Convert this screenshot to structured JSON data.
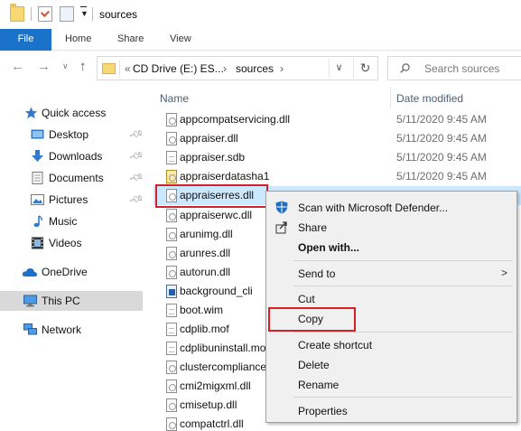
{
  "window": {
    "title": "sources"
  },
  "ribbon": {
    "tabs": [
      "File",
      "Home",
      "Share",
      "View"
    ]
  },
  "address": {
    "chevron": "«",
    "crumbs": [
      "CD Drive (E:) ES...",
      "sources"
    ],
    "separator": "›",
    "search_placeholder": "Search sources"
  },
  "navpane": {
    "items": [
      {
        "label": "Quick access",
        "icon": "star-icon"
      },
      {
        "label": "Desktop",
        "icon": "desktop-icon",
        "pinned": true
      },
      {
        "label": "Downloads",
        "icon": "download-arrow-icon",
        "pinned": true
      },
      {
        "label": "Documents",
        "icon": "documents-icon",
        "pinned": true
      },
      {
        "label": "Pictures",
        "icon": "pictures-icon",
        "pinned": true
      },
      {
        "label": "Music",
        "icon": "music-note-icon"
      },
      {
        "label": "Videos",
        "icon": "film-icon"
      },
      {
        "label": "OneDrive",
        "icon": "cloud-icon"
      },
      {
        "label": "This PC",
        "icon": "computer-icon",
        "selected": true
      },
      {
        "label": "Network",
        "icon": "network-icon"
      }
    ]
  },
  "list": {
    "columns": {
      "name": "Name",
      "date": "Date modified"
    },
    "files": [
      {
        "name": "appcompatservicing.dll",
        "date": "5/11/2020 9:45 AM",
        "icon": "dll-file-icon"
      },
      {
        "name": "appraiser.dll",
        "date": "5/11/2020 9:45 AM",
        "icon": "dll-file-icon"
      },
      {
        "name": "appraiser.sdb",
        "date": "5/11/2020 9:45 AM",
        "icon": "file-icon"
      },
      {
        "name": "appraiserdatasha1",
        "date": "5/11/2020 9:45 AM",
        "icon": "setup-file-icon"
      },
      {
        "name": "appraiserres.dll",
        "date": "",
        "icon": "dll-file-icon",
        "selected": true
      },
      {
        "name": "appraiserwc.dll",
        "date": "",
        "icon": "dll-file-icon"
      },
      {
        "name": "arunimg.dll",
        "date": "",
        "icon": "dll-file-icon"
      },
      {
        "name": "arunres.dll",
        "date": "",
        "icon": "dll-file-icon"
      },
      {
        "name": "autorun.dll",
        "date": "",
        "icon": "dll-file-icon"
      },
      {
        "name": "background_cli",
        "date": "",
        "icon": "image-file-icon"
      },
      {
        "name": "boot.wim",
        "date": "",
        "icon": "file-icon"
      },
      {
        "name": "cdplib.mof",
        "date": "",
        "icon": "file-icon"
      },
      {
        "name": "cdplibuninstall.mof",
        "date": "",
        "icon": "file-icon"
      },
      {
        "name": "clustercompliance",
        "date": "",
        "icon": "dll-file-icon"
      },
      {
        "name": "cmi2migxml.dll",
        "date": "",
        "icon": "dll-file-icon"
      },
      {
        "name": "cmisetup.dll",
        "date": "",
        "icon": "dll-file-icon"
      },
      {
        "name": "compatctrl.dll",
        "date": "",
        "icon": "dll-file-icon"
      }
    ]
  },
  "context_menu": {
    "items": [
      {
        "label": "Scan with Microsoft Defender...",
        "icon": "defender-shield-icon"
      },
      {
        "label": "Share",
        "icon": "share-icon"
      },
      {
        "label": "Open with...",
        "bold": true
      },
      {
        "label": "Send to",
        "submenu": true
      },
      {
        "label": "Cut"
      },
      {
        "label": "Copy",
        "highlighted": true
      },
      {
        "label": "Create shortcut"
      },
      {
        "label": "Delete"
      },
      {
        "label": "Rename"
      },
      {
        "label": "Properties"
      }
    ],
    "submenu_arrow": ">"
  },
  "colors": {
    "accent": "#1a73c8",
    "highlight": "#d32127",
    "selection": "#cce8ff"
  }
}
